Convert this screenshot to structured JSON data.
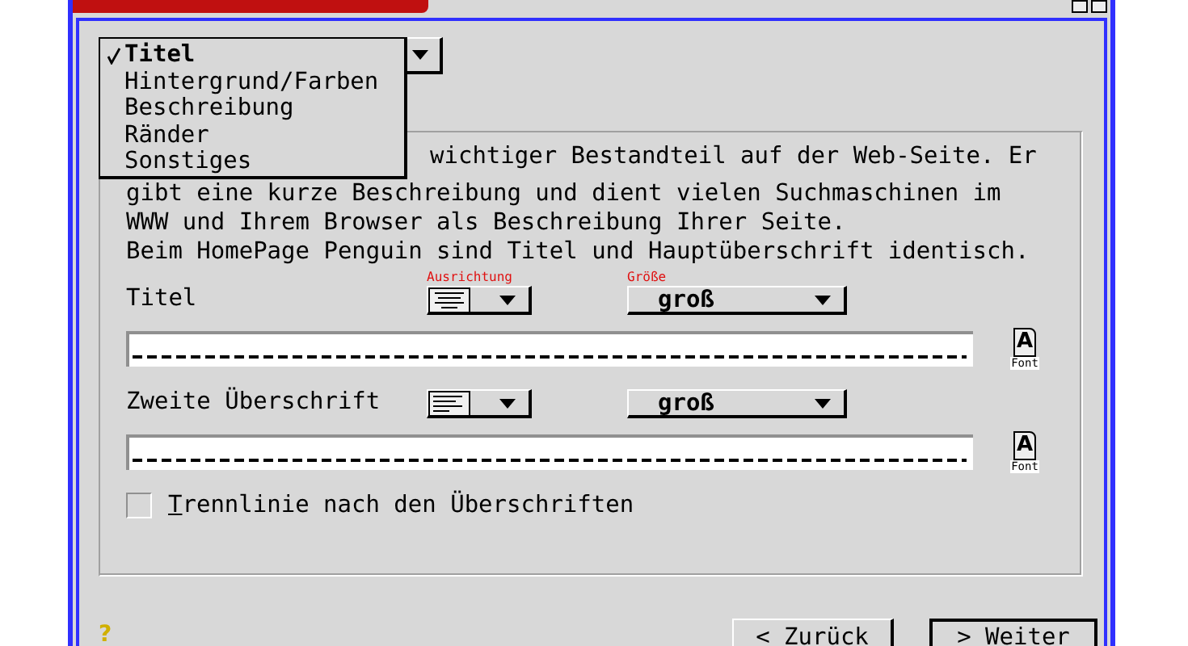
{
  "section_menu": {
    "items": [
      {
        "label": "Titel",
        "selected": true
      },
      {
        "label": "Hintergrund/Farben",
        "selected": false
      },
      {
        "label": "Beschreibung",
        "selected": false
      },
      {
        "label": "Ränder",
        "selected": false
      },
      {
        "label": "Sonstiges",
        "selected": false
      }
    ]
  },
  "description": {
    "lines": [
      "wichtiger Bestandteil auf der Web-Seite. Er",
      "gibt eine kurze Beschreibung und dient vielen Suchmaschinen im",
      "WWW und Ihrem Browser als Beschreibung Ihrer Seite.",
      "Beim HomePage Penguin sind Titel und Hauptüberschrift identisch."
    ]
  },
  "headings": [
    {
      "label": "Titel",
      "alignment_label": "Ausrichtung",
      "kind": "center",
      "size_label": "Größe",
      "size": "groß",
      "font_glyph": "A",
      "font_label": "Font"
    },
    {
      "label": "Zweite Überschrift",
      "kind": "left",
      "size": "groß",
      "font_glyph": "A",
      "font_label": "Font"
    }
  ],
  "separator_option": {
    "label": "Trennlinie nach den Überschriften",
    "checked": false
  },
  "help": {
    "glyph": "?"
  },
  "buttons": [
    {
      "label": "< Zurück",
      "default": false
    },
    {
      "label": "> Weiter",
      "default": true
    }
  ]
}
